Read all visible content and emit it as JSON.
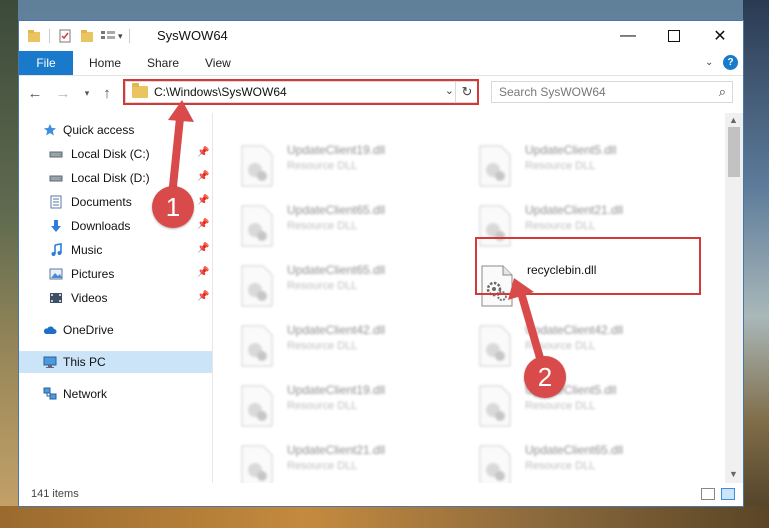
{
  "window": {
    "title": "SysWOW64"
  },
  "ribbon": {
    "tabs": [
      {
        "label": "File"
      },
      {
        "label": "Home"
      },
      {
        "label": "Share"
      },
      {
        "label": "View"
      }
    ]
  },
  "address": {
    "path": "C:\\Windows\\SysWOW64"
  },
  "search": {
    "placeholder": "Search SysWOW64"
  },
  "sidebar": {
    "items": [
      {
        "label": "Quick access",
        "icon": "star-icon"
      },
      {
        "label": "Local Disk (C:)",
        "icon": "drive-icon",
        "pinned": true
      },
      {
        "label": "Local Disk (D:)",
        "icon": "drive-icon",
        "pinned": true
      },
      {
        "label": "Documents",
        "icon": "documents-icon",
        "pinned": true
      },
      {
        "label": "Downloads",
        "icon": "download-icon",
        "pinned": true
      },
      {
        "label": "Music",
        "icon": "music-icon",
        "pinned": true
      },
      {
        "label": "Pictures",
        "icon": "pictures-icon",
        "pinned": true
      },
      {
        "label": "Videos",
        "icon": "videos-icon",
        "pinned": true
      },
      {
        "label": "OneDrive",
        "icon": "cloud-icon"
      },
      {
        "label": "This PC",
        "icon": "computer-icon",
        "selected": true
      },
      {
        "label": "Network",
        "icon": "network-icon"
      }
    ]
  },
  "files": [
    {
      "name": "UpdateClient19.dll",
      "type": "Resource DLL"
    },
    {
      "name": "UpdateClient5.dll",
      "type": "Resource DLL"
    },
    {
      "name": "UpdateClient65.dll",
      "type": "Resource DLL"
    },
    {
      "name": "UpdateClient21.dll",
      "type": "Resource DLL"
    },
    {
      "name": "UpdateClient65.dll",
      "type": "Resource DLL"
    },
    {
      "name": "recyclebin.dll",
      "type": ""
    },
    {
      "name": "UpdateClient42.dll",
      "type": "Resource DLL"
    },
    {
      "name": "UpdateClient42.dll",
      "type": "Resource DLL"
    },
    {
      "name": "UpdateClient19.dll",
      "type": "Resource DLL"
    },
    {
      "name": "UpdateClient5.dll",
      "type": "Resource DLL"
    },
    {
      "name": "UpdateClient21.dll",
      "type": "Resource DLL"
    },
    {
      "name": "UpdateClient65.dll",
      "type": "Resource DLL"
    },
    {
      "name": "",
      "type": ""
    },
    {
      "name": "",
      "type": ""
    }
  ],
  "status": {
    "item_count": "141 items"
  },
  "annotations": {
    "marker1": "1",
    "marker2": "2"
  },
  "colors": {
    "accent": "#1979ca",
    "highlight": "#d23a3a",
    "selected_bg": "#cce4f7"
  }
}
